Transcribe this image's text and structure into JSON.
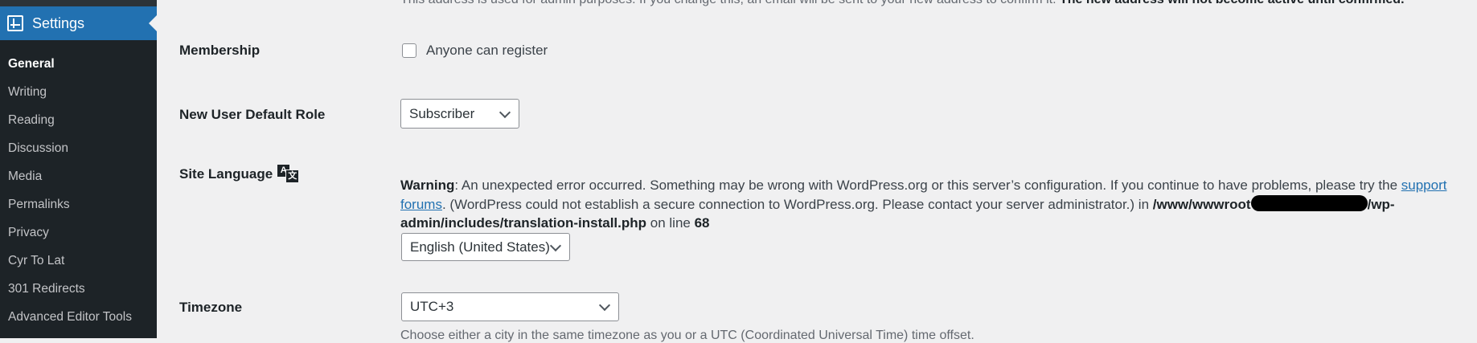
{
  "sidebar": {
    "settings_label": "Settings",
    "settings_icon": "settings-sliders-icon",
    "items": [
      {
        "label": "General",
        "current": true
      },
      {
        "label": "Writing"
      },
      {
        "label": "Reading"
      },
      {
        "label": "Discussion"
      },
      {
        "label": "Media"
      },
      {
        "label": "Permalinks"
      },
      {
        "label": "Privacy"
      },
      {
        "label": "Cyr To Lat"
      },
      {
        "label": "301 Redirects"
      },
      {
        "label": "Advanced Editor Tools"
      }
    ]
  },
  "admin_email": {
    "description": "This address is used for admin purposes. If you change this, an email will be sent to your new address to confirm it.",
    "description_bold": "The new address will not become active until confirmed."
  },
  "membership": {
    "label": "Membership",
    "checkbox_label": "Anyone can register",
    "checked": false
  },
  "default_role": {
    "label": "New User Default Role",
    "value": "Subscriber"
  },
  "site_language": {
    "label": "Site Language",
    "icon": "translation-icon",
    "icon_glyph_a": "A",
    "icon_glyph_b": "文",
    "warning_label": "Warning",
    "warning_text_1": ": An unexpected error occurred. Something may be wrong with WordPress.org or this server’s configuration. If you continue to have problems, please try the ",
    "warning_link": "support forums",
    "warning_text_2": ". (WordPress could not establish a secure connection to WordPress.org. Please contact your server administrator.) in ",
    "path_start": "/www/wwwroot",
    "path_end": "/wp-admin/includes/translation-install.php",
    "on_line_text": " on line ",
    "line_number": "68",
    "value": "English (United States)"
  },
  "timezone": {
    "label": "Timezone",
    "value": "UTC+3",
    "description": "Choose either a city in the same timezone as you or a UTC (Coordinated Universal Time) time offset."
  }
}
